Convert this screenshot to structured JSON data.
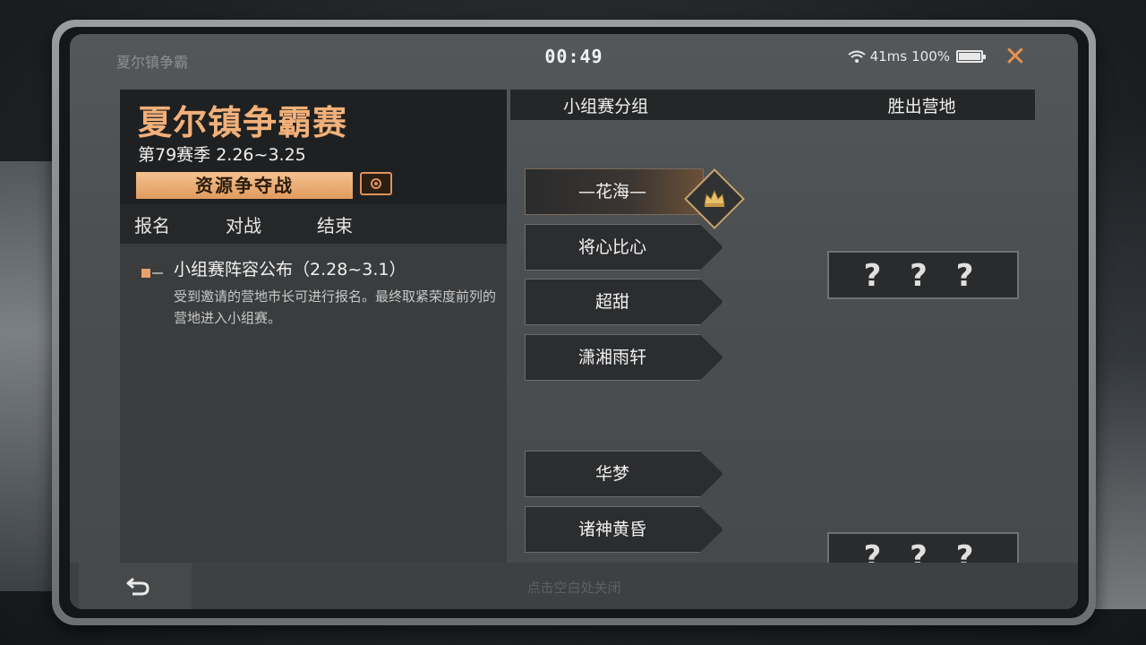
{
  "status": {
    "app_title": "夏尔镇争霸",
    "clock": "00:49",
    "latency": "41ms",
    "battery": "100%"
  },
  "event": {
    "title": "夏尔镇争霸赛",
    "season": "第79赛季  2.26~3.25",
    "mode": "资源争夺战"
  },
  "phases": [
    "报名",
    "对战",
    "结束"
  ],
  "stage": {
    "title": "小组赛阵容公布（2.28~3.1）",
    "description": "受到邀请的营地市长可进行报名。最终取紧荣度前列的营地进入小组赛。"
  },
  "bracket": {
    "groups_header": "小组赛分组",
    "winners_header": "胜出营地",
    "teams": [
      "—花海—",
      "将心比心",
      "超甜",
      "潇湘雨轩",
      "华梦",
      "诸神黄昏"
    ],
    "winner_placeholders": [
      "? ? ?",
      "? ? ?"
    ]
  },
  "footer": {
    "hint": "点击空白处关闭"
  },
  "colors": {
    "accent_orange": "#f2b07a",
    "close_orange": "#e8914d",
    "banner_gold": "#e19b5e"
  },
  "icons": [
    "wifi-icon",
    "battery-icon",
    "close-icon",
    "mode-info-icon",
    "crown-icon",
    "back-arrow-icon"
  ]
}
